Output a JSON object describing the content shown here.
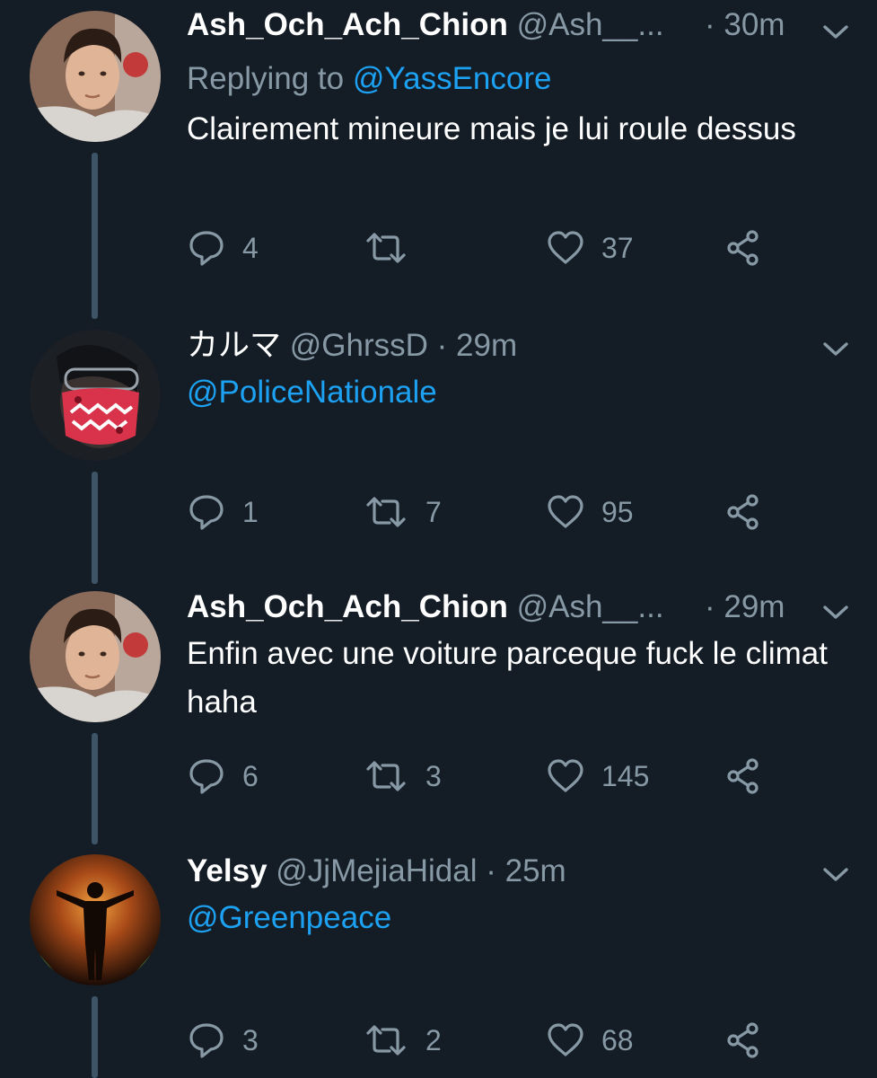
{
  "icons": {
    "reply": "reply-icon",
    "retweet": "retweet-icon",
    "like": "heart-icon",
    "share": "share-icon",
    "more": "chevron-down-icon"
  },
  "colors": {
    "background": "#141d26",
    "text": "#ffffff",
    "muted": "#8899a6",
    "link": "#1da1f2",
    "thread_line": "#3d5466"
  },
  "tweets": [
    {
      "name": "Ash_Och_Ach_Chion",
      "handle": "@Ash__...",
      "time": "· 30m",
      "replying_prefix": "Replying to ",
      "replying_to": "@YassEncore",
      "text": "Clairement mineure mais je lui roule dessus",
      "replies": "4",
      "retweets": "",
      "likes": "37"
    },
    {
      "name": "カルマ",
      "handle": "@GhrssD",
      "time": "· 29m",
      "mention": "@PoliceNationale",
      "replies": "1",
      "retweets": "7",
      "likes": "95"
    },
    {
      "name": "Ash_Och_Ach_Chion",
      "handle": "@Ash__...",
      "time": "· 29m",
      "text": "Enfin avec une voiture parceque fuck le climat haha",
      "replies": "6",
      "retweets": "3",
      "likes": "145"
    },
    {
      "name": "Yelsy",
      "handle": "@JjMejiaHidal",
      "time": "· 25m",
      "mention": "@Greenpeace",
      "replies": "3",
      "retweets": "2",
      "likes": "68"
    }
  ]
}
